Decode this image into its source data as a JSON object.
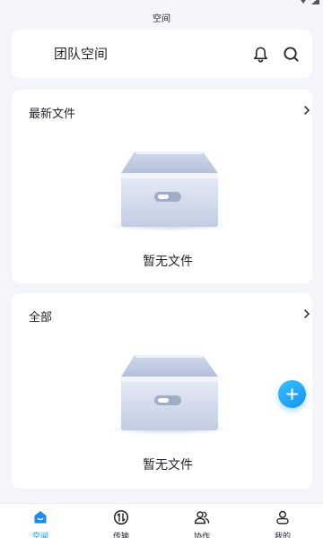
{
  "app_title": "空间",
  "header": {
    "title": "团队空间",
    "bell_icon": "bell-icon",
    "search_icon": "search-icon"
  },
  "sections": {
    "recent": {
      "title": "最新文件",
      "empty_text": "暂无文件"
    },
    "all": {
      "title": "全部",
      "empty_text": "暂无文件"
    }
  },
  "fab": {
    "icon": "plus-icon"
  },
  "tabs": [
    {
      "label": "空间",
      "icon": "home-icon",
      "active": true
    },
    {
      "label": "传输",
      "icon": "transfer-icon",
      "active": false
    },
    {
      "label": "协作",
      "icon": "team-icon",
      "active": false
    },
    {
      "label": "我的",
      "icon": "user-icon",
      "active": false
    }
  ],
  "colors": {
    "accent": "#1a8cf0",
    "background": "#f3f5fa",
    "card": "#ffffff",
    "text": "#1f2329"
  }
}
